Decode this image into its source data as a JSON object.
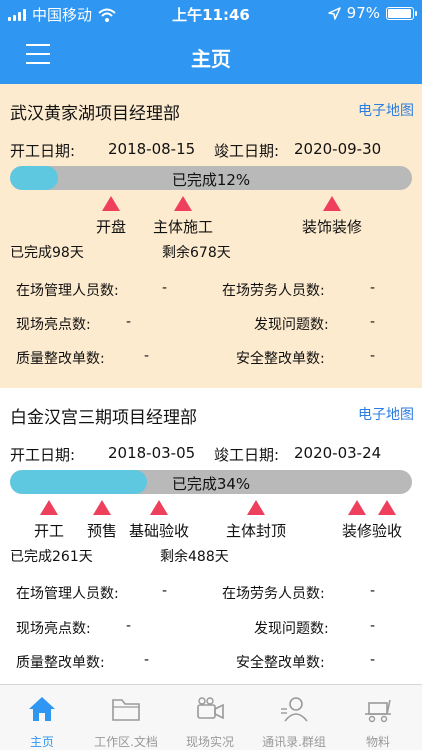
{
  "status_bar": {
    "carrier": "中国移动",
    "time": "上午11:46",
    "battery": "97%",
    "battery_level": 0.97
  },
  "nav": {
    "title": "主页"
  },
  "projects": [
    {
      "name": "武汉黄家湖项目经理部",
      "map_link": "电子地图",
      "start_label": "开工日期:",
      "start_date": "2018-08-15",
      "end_label": "竣工日期:",
      "end_date": "2020-09-30",
      "progress_text": "已完成12%",
      "progress": 0.12,
      "milestones": [
        "开盘",
        "主体施工",
        "装饰装修"
      ],
      "done_days": "已完成98天",
      "remaining_days": "剩余678天",
      "stats": [
        {
          "label": "在场管理人员数:",
          "value": "-"
        },
        {
          "label": "在场劳务人员数:",
          "value": "-"
        },
        {
          "label": "现场亮点数:",
          "value": "-"
        },
        {
          "label": "发现问题数:",
          "value": "-"
        },
        {
          "label": "质量整改单数:",
          "value": "-"
        },
        {
          "label": "安全整改单数:",
          "value": "-"
        }
      ]
    },
    {
      "name": "白金汉宫三期项目经理部",
      "map_link": "电子地图",
      "start_label": "开工日期:",
      "start_date": "2018-03-05",
      "end_label": "竣工日期:",
      "end_date": "2020-03-24",
      "progress_text": "已完成34%",
      "progress": 0.34,
      "milestones": [
        "开工",
        "预售",
        "基础验收",
        "主体封顶",
        "装修验收"
      ],
      "done_days": "已完成261天",
      "remaining_days": "剩余488天",
      "stats": [
        {
          "label": "在场管理人员数:",
          "value": "-"
        },
        {
          "label": "在场劳务人员数:",
          "value": "-"
        },
        {
          "label": "现场亮点数:",
          "value": "-"
        },
        {
          "label": "发现问题数:",
          "value": "-"
        },
        {
          "label": "质量整改单数:",
          "value": "-"
        },
        {
          "label": "安全整改单数:",
          "value": "-"
        }
      ]
    }
  ],
  "tabs": [
    {
      "label": "主页",
      "icon": "home-icon",
      "active": true
    },
    {
      "label": "工作区.文档",
      "icon": "folder-icon",
      "active": false
    },
    {
      "label": "现场实况",
      "icon": "camera-icon",
      "active": false
    },
    {
      "label": "通讯录.群组",
      "icon": "contacts-icon",
      "active": false
    },
    {
      "label": "物料",
      "icon": "cart-icon",
      "active": false
    }
  ],
  "colors": {
    "accent": "#2f97f2",
    "milestone": "#ee3f5c",
    "progress_fill": "#5ec8e0",
    "card1_bg": "#fdebcf"
  }
}
